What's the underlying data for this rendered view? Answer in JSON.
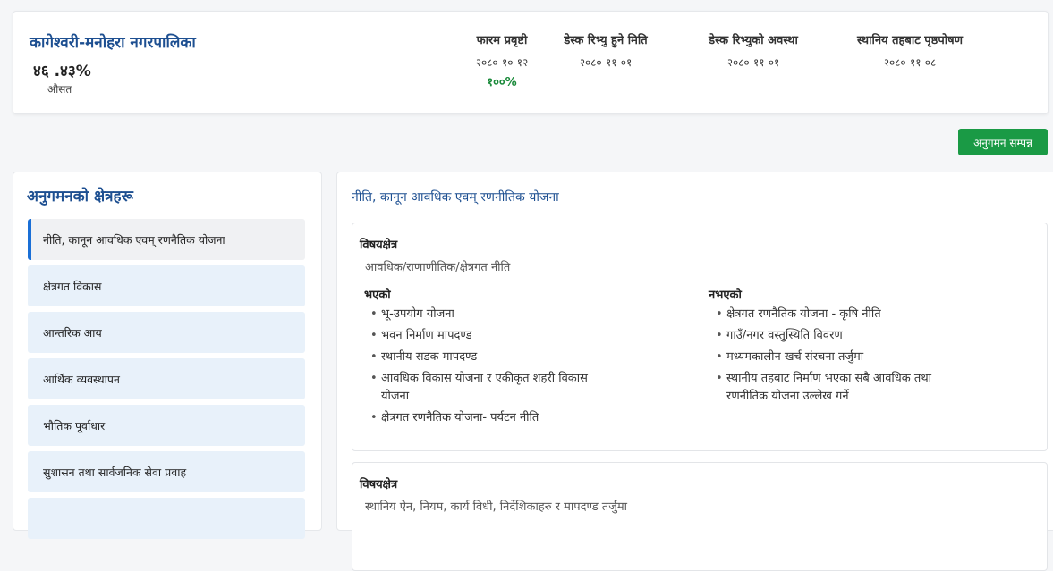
{
  "header": {
    "municipality": "कागेश्वरी-मनोहरा नगरपालिका",
    "average_value": "४६ .४३%",
    "average_label": "औसत",
    "stats": [
      {
        "heading": "फारम प्रबृष्टी",
        "value": "२०८०-१०-१२",
        "percent": "१००%"
      },
      {
        "heading": "डेस्क रिभ्यु हुने मिति",
        "value": "२०८०-११-०१"
      },
      {
        "heading": "डेस्क रिभ्युको अवस्था",
        "value": "२०८०-११-०१"
      },
      {
        "heading": "स्थानिय तहबाट पृष्ठपोषण",
        "value": "२०८०-११-०८"
      }
    ]
  },
  "actions": {
    "complete_button": "अनुगमन सम्पन्न"
  },
  "areas": {
    "title": "अनुगमनको क्षेत्रहरू",
    "items": [
      "नीति, कानून आवधिक एवम् रणनैतिक योजना",
      "क्षेत्रगत विकास",
      "आन्तरिक आय",
      "आर्थिक व्यवस्थापन",
      "भौतिक पूर्वाधार",
      "सुशासन तथा सार्वजनिक सेवा प्रवाह"
    ],
    "active_index": 0
  },
  "detail": {
    "title": "नीति, कानून आवधिक एवम् रणनीतिक योजना",
    "sections": [
      {
        "label": "विषयक्षेत्र",
        "value": "आवधिक/राणाणीतिक/क्षेत्रगत नीति",
        "done_heading": "भएको",
        "done_items": [
          "भू-उपयोग योजना",
          "भवन निर्माण मापदण्ड",
          "स्थानीय सडक मापदण्ड",
          "आवधिक विकास  योजना र एकीकृत शहरी विकास योजना",
          "क्षेत्रगत रणनैतिक योजना- पर्यटन नीति"
        ],
        "notdone_heading": "नभएको",
        "notdone_items": [
          "क्षेत्रगत रणनैतिक योजना - कृषि नीति",
          "गाउँ/नगर वस्तुस्थिति विवरण",
          "मध्यमकालीन खर्च संरचना तर्जुमा",
          "स्थानीय तहबाट निर्माण भएका सबै आवधिक तथा रणनीतिक  योजना उल्लेख गर्ने"
        ]
      },
      {
        "label": "विषयक्षेत्र",
        "value": "स्थानिय ऐन, नियम, कार्य विधी, निर्देशिकाहरु र मापदण्ड तर्जुमा"
      }
    ]
  }
}
